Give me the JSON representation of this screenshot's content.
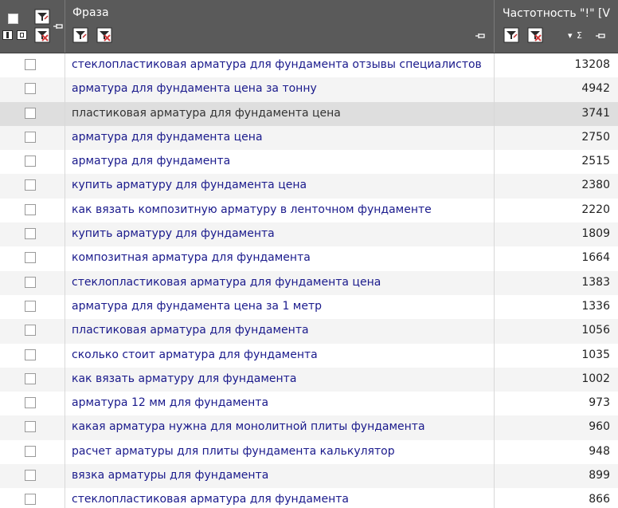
{
  "header": {
    "phrase_title": "Фраза",
    "freq_title": "Частотность \"!\" [V",
    "sort_sum_label": "▾ Σ"
  },
  "colors": {
    "header_bg": "#5a5a5a",
    "link_text": "#1a1a8c",
    "selected_row": "#dedede",
    "alt_row": "#f4f4f4"
  },
  "icons": {
    "filter_add": "filter-edit-icon",
    "filter_clear": "filter-clear-icon",
    "pin": "pin-icon"
  },
  "rows": [
    {
      "phrase": "стеклопластиковая арматура для фундамента отзывы специалистов",
      "freq": "13208"
    },
    {
      "phrase": "арматура для фундамента цена за тонну",
      "freq": "4942"
    },
    {
      "phrase": "пластиковая арматура для фундамента цена",
      "freq": "3741",
      "selected": true
    },
    {
      "phrase": "арматура для фундамента цена",
      "freq": "2750"
    },
    {
      "phrase": "арматура для фундамента",
      "freq": "2515"
    },
    {
      "phrase": "купить арматуру для фундамента цена",
      "freq": "2380"
    },
    {
      "phrase": "как вязать композитную арматуру в ленточном фундаменте",
      "freq": "2220"
    },
    {
      "phrase": "купить арматуру для фундамента",
      "freq": "1809"
    },
    {
      "phrase": "композитная арматура для фундамента",
      "freq": "1664"
    },
    {
      "phrase": "стеклопластиковая арматура для фундамента цена",
      "freq": "1383"
    },
    {
      "phrase": "арматура для фундамента цена за 1 метр",
      "freq": "1336"
    },
    {
      "phrase": "пластиковая арматура для фундамента",
      "freq": "1056"
    },
    {
      "phrase": "сколько стоит арматура для фундамента",
      "freq": "1035"
    },
    {
      "phrase": "как вязать арматуру для фундамента",
      "freq": "1002"
    },
    {
      "phrase": "арматура 12 мм для фундамента",
      "freq": "973"
    },
    {
      "phrase": "какая арматура нужна для монолитной плиты фундамента",
      "freq": "960"
    },
    {
      "phrase": "расчет арматуры для плиты фундамента калькулятор",
      "freq": "948"
    },
    {
      "phrase": "вязка арматуры для фундамента",
      "freq": "899"
    },
    {
      "phrase": "стеклопластиковая арматура для фундамента",
      "freq": "866"
    }
  ]
}
